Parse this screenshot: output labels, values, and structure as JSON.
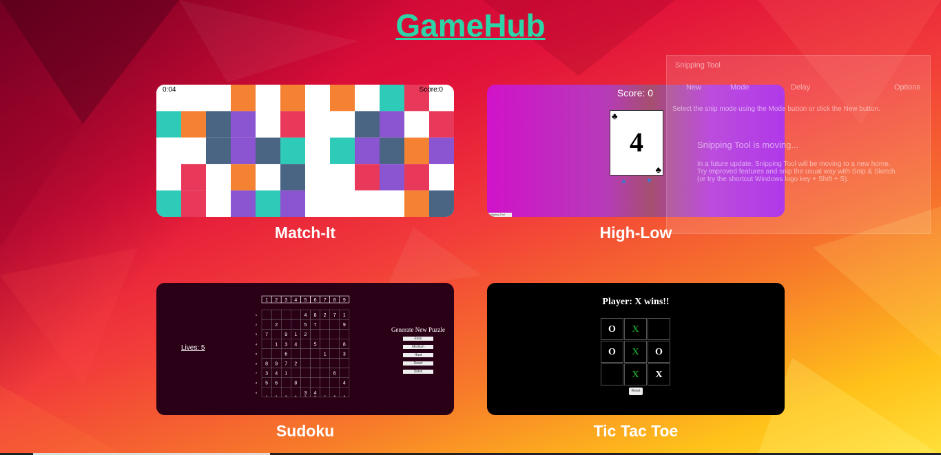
{
  "site": {
    "title": "GameHub"
  },
  "games": {
    "match": {
      "caption": "Match-It",
      "time": "0:04",
      "score": "Score:0",
      "grid_colors": [
        [
          "#fff",
          "#fff",
          "#fff",
          "#f58233",
          "#fff",
          "#f58233",
          "#fff",
          "#f58233",
          "#fff",
          "#2dcbb8",
          "#e8395a",
          "#fff"
        ],
        [
          "#2dcbb8",
          "#f58233",
          "#4a6584",
          "#8b54d0",
          "#fff",
          "#e8395a",
          "#fff",
          "#fff",
          "#4a6584",
          "#8b54d0",
          "#fff",
          "#e8395a"
        ],
        [
          "#fff",
          "#fff",
          "#4a6584",
          "#8b54d0",
          "#4a6584",
          "#2dcbb8",
          "#fff",
          "#2dcbb8",
          "#8b54d0",
          "#4a6584",
          "#f58233",
          "#8b54d0"
        ],
        [
          "#fff",
          "#e8395a",
          "#fff",
          "#f58233",
          "#fff",
          "#4a6584",
          "#fff",
          "#fff",
          "#e8395a",
          "#8b54d0",
          "#e8395a",
          "#fff"
        ],
        [
          "#2dcbb8",
          "#e8395a",
          "#fff",
          "#8b54d0",
          "#2dcbb8",
          "#8b54d0",
          "#fff",
          "#fff",
          "#fff",
          "#fff",
          "#f58233",
          "#4a6584"
        ]
      ]
    },
    "hilo": {
      "caption": "High-Low",
      "score": "Score: 0",
      "card_value": "4",
      "suit": "♣",
      "up_arrow": "▲",
      "down_arrow": "▼",
      "tooltip": "Snipping Tool"
    },
    "sudoku": {
      "caption": "Sudoku",
      "lives": "Lives: 5",
      "header_numbers": [
        "1",
        "2",
        "3",
        "4",
        "5",
        "6",
        "7",
        "8",
        "9"
      ],
      "row_numbers": [
        "1",
        "2",
        "3",
        "4",
        "5",
        "6",
        "7",
        "8",
        "9"
      ],
      "cells": [
        [
          "",
          "",
          "",
          "",
          "4",
          "8",
          "2",
          "7",
          "1"
        ],
        [
          "",
          "2",
          "",
          "",
          "5",
          "7",
          "",
          "",
          "9"
        ],
        [
          "7",
          "",
          "9",
          "1",
          "2",
          "",
          "",
          "",
          ""
        ],
        [
          "",
          "1",
          "3",
          "4",
          "",
          "5",
          "",
          "",
          "8"
        ],
        [
          "",
          "",
          "6",
          "",
          "",
          "",
          "1",
          "",
          "3"
        ],
        [
          "8",
          "9",
          "7",
          "2",
          "",
          "",
          "",
          "",
          ""
        ],
        [
          "3",
          "4",
          "1",
          "",
          "",
          "",
          "",
          "6",
          ""
        ],
        [
          "5",
          "6",
          "",
          "8",
          "",
          "",
          "",
          "",
          "4"
        ],
        [
          "",
          "",
          "",
          "",
          "3",
          "4",
          "",
          "",
          ""
        ]
      ],
      "generate_label": "Generate New Puzzle",
      "buttons": [
        "Easy",
        "Medium",
        "Hard",
        "Reset",
        "Solve"
      ]
    },
    "ttt": {
      "caption": "Tic Tac Toe",
      "status": "Player: X wins!!",
      "board": [
        [
          "O",
          "X",
          ""
        ],
        [
          "O",
          "X",
          "O"
        ],
        [
          "",
          "X",
          "X"
        ]
      ],
      "reset": "Reset"
    }
  },
  "snipping_tool": {
    "title": "Snipping Tool",
    "new": "New",
    "mode": "Mode",
    "delay": "Delay",
    "options": "Options",
    "hint": "Select the snip mode using the Mode button or click the New button.",
    "moving_title": "Snipping Tool is moving...",
    "moving_body": "In a future update, Snipping Tool will be moving to a new home. Try improved features and snip the usual way with Snip & Sketch (or try the shortcut Windows logo key + Shift + S)."
  },
  "colors": {
    "title": "#2dd4a8",
    "accent_orange": "#f58233",
    "accent_teal": "#2dcbb8",
    "accent_red": "#e8395a",
    "accent_purple": "#8b54d0",
    "accent_slate": "#4a6584"
  }
}
